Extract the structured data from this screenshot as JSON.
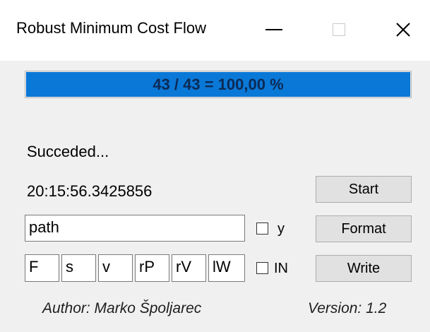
{
  "window": {
    "title": "Robust Minimum Cost Flow",
    "controls": [
      "minimize-icon",
      "maximize-icon",
      "close-icon"
    ]
  },
  "progress": {
    "text": "43 / 43 = 100,00 %",
    "fraction": 1.0,
    "color": "#0a78d7"
  },
  "status_text": "Succeded...",
  "time_text": "20:15:56.3425856",
  "buttons": {
    "start": "Start",
    "format": "Format",
    "write": "Write"
  },
  "path_input": {
    "value": "path"
  },
  "small_inputs": [
    "F",
    "s",
    "v",
    "rP",
    "rV",
    "lW"
  ],
  "checkboxes": {
    "y": {
      "label": "y",
      "checked": false
    },
    "in": {
      "label": "IN",
      "checked": false
    }
  },
  "footer": {
    "author": "Author: Marko Špoljarec",
    "version": "Version: 1.2"
  }
}
